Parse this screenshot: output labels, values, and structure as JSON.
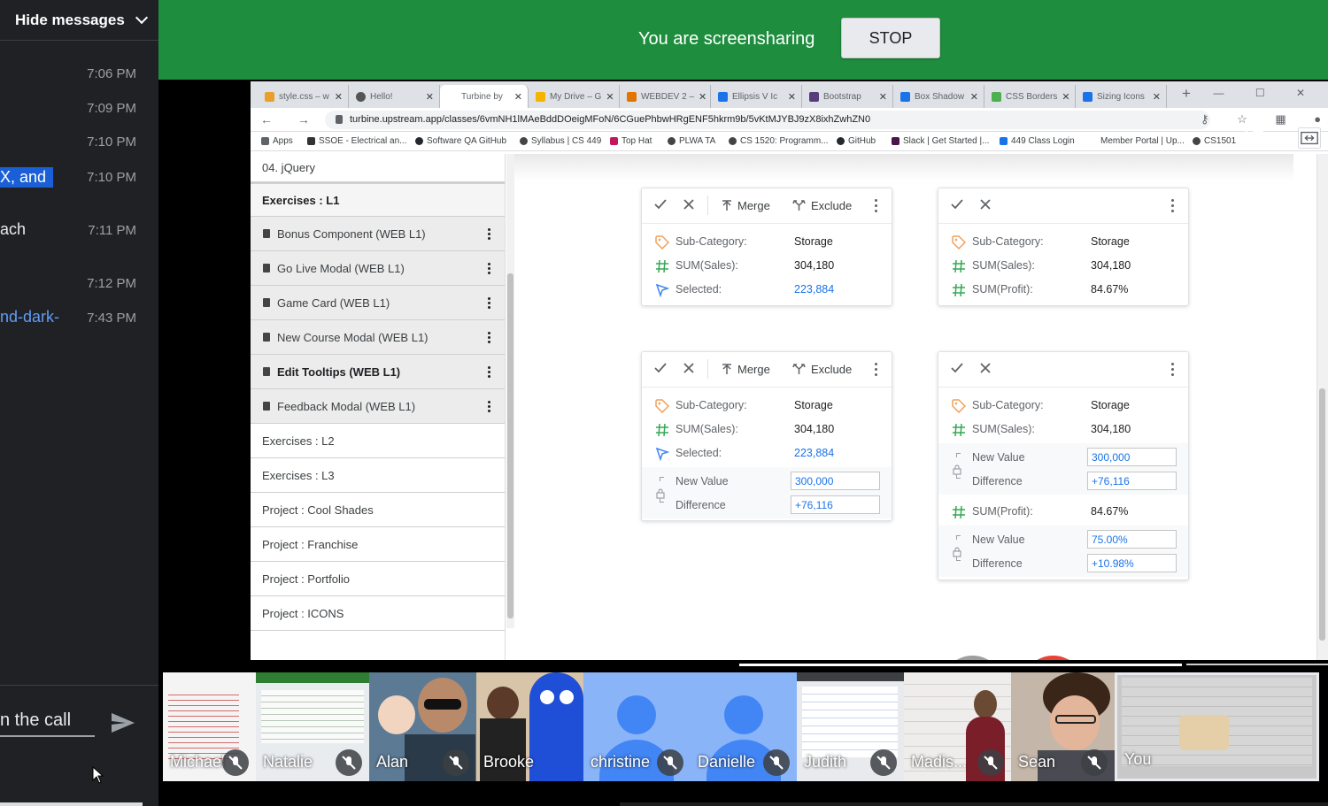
{
  "chat": {
    "header": "Hide messages",
    "messages": [
      {
        "text": "",
        "time": "7:06 PM"
      },
      {
        "text": "",
        "time": "7:09 PM"
      },
      {
        "text": "",
        "time": "7:10 PM"
      },
      {
        "text": "X, and",
        "time": "7:10 PM"
      },
      {
        "text": "ach",
        "time": "7:11 PM"
      },
      {
        "text": "",
        "time": "7:12 PM"
      },
      {
        "text": "nd-dark-",
        "time": "7:43 PM"
      }
    ],
    "input_placeholder": "n the call"
  },
  "banner": {
    "text": "You are screensharing",
    "stop_label": "STOP",
    "bg_color": "#1e8e3e"
  },
  "browser": {
    "tabs": [
      {
        "label": "style.css – w",
        "color": "#e8a02a"
      },
      {
        "label": "Hello!",
        "color": "#555"
      },
      {
        "label": "Turbine by",
        "color": "#fff"
      },
      {
        "label": "My Drive – G",
        "color": "#f4b400"
      },
      {
        "label": "WEBDEV 2 –",
        "color": "#e37400"
      },
      {
        "label": "Ellipsis V Ic",
        "color": "#1a73e8"
      },
      {
        "label": "Bootstrap",
        "color": "#563d7c"
      },
      {
        "label": "Box Shadow",
        "color": "#1a73e8"
      },
      {
        "label": "CSS Borders",
        "color": "#4caf50"
      },
      {
        "label": "Sizing Icons",
        "color": "#1a73e8"
      }
    ],
    "url": "turbine.upstream.app/classes/6vmNH1lMAeBddDOeigMFoN/6CGuePhbwHRgENF5hkrm9b/5vKtMJYBJ9zX8ixhZwhZN0",
    "bookmarks": [
      "Apps",
      "SSOE - Electrical an...",
      "Software QA GitHub",
      "Syllabus | CS 449",
      "Top Hat",
      "PLWA TA",
      "CS 1520: Programm...",
      "GitHub",
      "Slack | Get Started |...",
      "449 Class Login",
      "Member Portal | Up...",
      "CS1501"
    ]
  },
  "course_list": {
    "items": [
      {
        "label": "04. jQuery",
        "kind": "plain"
      },
      {
        "label": "Exercises : L1",
        "kind": "heading"
      },
      {
        "label": "Bonus Component (WEB L1)",
        "kind": "sub"
      },
      {
        "label": "Go Live Modal (WEB L1)",
        "kind": "sub"
      },
      {
        "label": "Game Card (WEB L1)",
        "kind": "sub"
      },
      {
        "label": "New Course Modal (WEB L1)",
        "kind": "sub"
      },
      {
        "label": "Edit Tooltips (WEB L1)",
        "kind": "sub-bold"
      },
      {
        "label": "Feedback Modal (WEB L1)",
        "kind": "sub"
      },
      {
        "label": "Exercises : L2",
        "kind": "plain"
      },
      {
        "label": "Exercises : L3",
        "kind": "plain"
      },
      {
        "label": "Project : Cool Shades",
        "kind": "plain"
      },
      {
        "label": "Project : Franchise",
        "kind": "plain"
      },
      {
        "label": "Project : Portfolio",
        "kind": "plain"
      },
      {
        "label": "Project : ICONS",
        "kind": "plain"
      }
    ]
  },
  "cards": {
    "merge_label": "Merge",
    "exclude_label": "Exclude",
    "c1": {
      "rows": [
        {
          "label": "Sub-Category:",
          "value": "Storage"
        },
        {
          "label": "SUM(Sales):",
          "value": "304,180"
        },
        {
          "label": "Selected:",
          "value": "223,884"
        }
      ]
    },
    "c2": {
      "rows": [
        {
          "label": "Sub-Category:",
          "value": "Storage"
        },
        {
          "label": "SUM(Sales):",
          "value": "304,180"
        },
        {
          "label": "SUM(Profit):",
          "value": "84.67%"
        }
      ]
    },
    "c3": {
      "rows": [
        {
          "label": "Sub-Category:",
          "value": "Storage"
        },
        {
          "label": "SUM(Sales):",
          "value": "304,180"
        },
        {
          "label": "Selected:",
          "value": "223,884"
        }
      ],
      "new_value_label": "New Value",
      "new_value": "300,000",
      "difference_label": "Difference",
      "difference": "+76,116"
    },
    "c4": {
      "rows": [
        {
          "label": "Sub-Category:",
          "value": "Storage"
        },
        {
          "label": "SUM(Sales):",
          "value": "304,180"
        }
      ],
      "new_value_label": "New Value",
      "new_value": "300,000",
      "difference_label": "Difference",
      "difference": "+76,116",
      "profit_label": "SUM(Profit):",
      "profit_value": "84.67%",
      "new_value2": "75.00%",
      "difference2": "+10.98%"
    }
  },
  "participants": [
    {
      "name": "Michael",
      "bg": "#f4f4f4"
    },
    {
      "name": "Natalie",
      "bg": "#e9ecef"
    },
    {
      "name": "Alan",
      "bg": "#5d7a94"
    },
    {
      "name": "Brooke",
      "bg": "#c94f3c"
    },
    {
      "name": "christine",
      "bg": "#8ab4f8"
    },
    {
      "name": "Danielle",
      "bg": "#8ab4f8"
    },
    {
      "name": "Judith",
      "bg": "#e8eaed"
    },
    {
      "name": "Madis...",
      "bg": "#e6e4e2"
    },
    {
      "name": "Sean",
      "bg": "#c4b6a8"
    },
    {
      "name": "You",
      "bg": "#c8c8c8"
    }
  ]
}
